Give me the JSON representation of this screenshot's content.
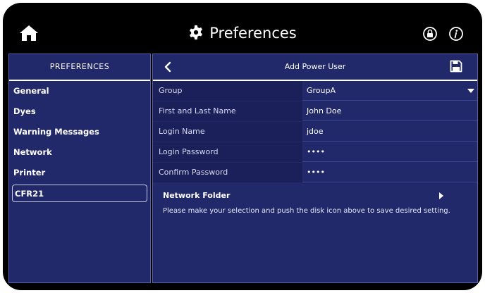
{
  "header": {
    "title": "Preferences",
    "icons": [
      "home-icon",
      "gear-icon",
      "lock-icon",
      "info-icon"
    ]
  },
  "sidebar": {
    "header": "PREFERENCES",
    "items": [
      {
        "label": "General",
        "selected": false
      },
      {
        "label": "Dyes",
        "selected": false
      },
      {
        "label": "Warning Messages",
        "selected": false
      },
      {
        "label": "Network",
        "selected": false
      },
      {
        "label": "Printer",
        "selected": false
      },
      {
        "label": "CFR21",
        "selected": true
      }
    ]
  },
  "main": {
    "title": "Add Power User",
    "icons": [
      "back-icon",
      "save-icon"
    ],
    "fields": [
      {
        "label": "Group",
        "value": "GroupA",
        "type": "dropdown"
      },
      {
        "label": "First and Last Name",
        "value": "John Doe",
        "type": "text"
      },
      {
        "label": "Login Name",
        "value": "jdoe",
        "type": "text"
      },
      {
        "label": "Login Password",
        "value": "••••",
        "type": "password"
      },
      {
        "label": "Confirm Password",
        "value": "••••",
        "type": "password"
      }
    ],
    "network_folder": "Network Folder",
    "instruction": "Please make your selection and push the disk icon above to save desired setting."
  },
  "colors": {
    "background": "#000000",
    "panel": "#22296a",
    "label_cell": "#1b1f5a",
    "text": "#ffffff"
  }
}
